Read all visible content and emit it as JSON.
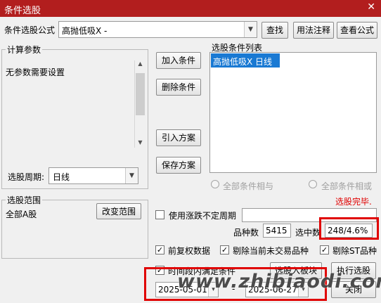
{
  "window": {
    "title": "条件选股"
  },
  "formula": {
    "label": "条件选股公式",
    "value": "高抛低吸X  -",
    "buttons": {
      "find": "查找",
      "usage": "用法注释",
      "view": "查看公式"
    }
  },
  "params": {
    "group_label": "计算参数",
    "text": "无参数需要设置",
    "period_label": "选股周期:",
    "period_value": "日线"
  },
  "actions": {
    "add": "加入条件",
    "delete": "删除条件",
    "import": "引入方案",
    "save": "保存方案"
  },
  "condition_list": {
    "label": "选股条件列表",
    "items": [
      "高抛低吸X  日线"
    ]
  },
  "logic": {
    "all_and": "全部条件相与",
    "all_or": "全部条件相或"
  },
  "status": {
    "done": "选股完毕."
  },
  "range": {
    "group_label": "选股范围",
    "value": "全部A股",
    "change_button": "改变范围"
  },
  "uncertain_period": {
    "label": "使用涨跌不定周期"
  },
  "stats": {
    "count_label": "品种数",
    "count_value": "5415",
    "selected_label": "选中数",
    "selected_value": "248/4.6%"
  },
  "options": {
    "prior_rights": "前复权数据",
    "exclude_untraded": "剔除当前未交易品种",
    "exclude_st": "剔除ST品种",
    "time_condition": "时间段内满足条件"
  },
  "bottom_buttons": {
    "to_block": "选股入板块",
    "execute": "执行选股",
    "close": "关闭"
  },
  "dates": {
    "start": "2025-05-01",
    "end": "2025-06-27",
    "separator": "-"
  },
  "watermark": {
    "text": "www.zhibiaodi.com"
  },
  "colors": {
    "titlebar": "#b21e1e",
    "selection": "#1979d3",
    "highlight_box": "#e00000",
    "status_red": "#e00000"
  }
}
